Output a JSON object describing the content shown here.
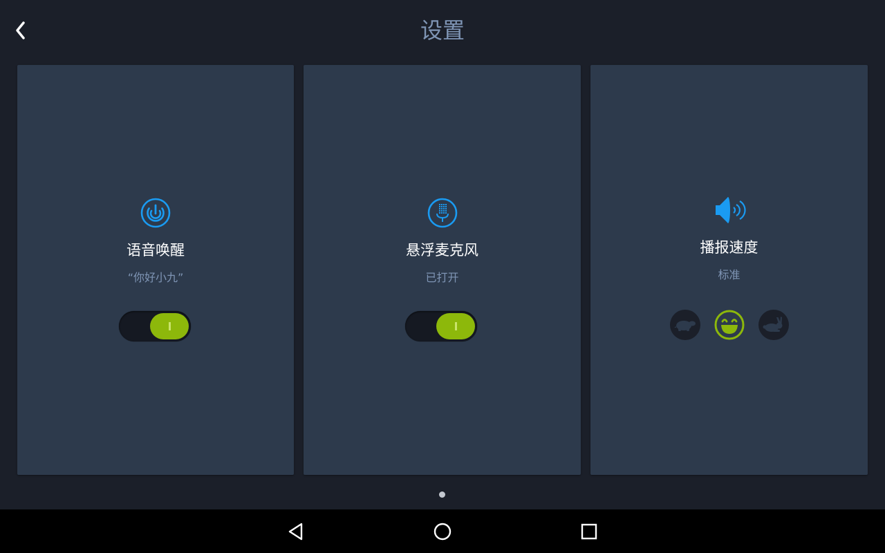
{
  "header": {
    "title": "设置",
    "back_icon": "chevron-left-icon"
  },
  "cards": [
    {
      "icon": "wake-power-icon",
      "title": "语音唤醒",
      "subtitle": "“你好小九”",
      "toggle_on": true
    },
    {
      "icon": "microphone-icon",
      "title": "悬浮麦克风",
      "subtitle": "已打开",
      "toggle_on": true
    },
    {
      "icon": "speaker-icon",
      "title": "播报速度",
      "subtitle": "标准",
      "speed_options": [
        "turtle-icon",
        "smiley-icon",
        "rabbit-icon"
      ],
      "selected_speed": 1
    }
  ],
  "pager": {
    "pages": 1,
    "current": 1
  },
  "navbar": {
    "back_icon": "nav-back-icon",
    "home_icon": "nav-home-icon",
    "recents_icon": "nav-recents-icon"
  },
  "colors": {
    "background": "#1b1f29",
    "card": "#2d3a4c",
    "accent_blue": "#1a9bf2",
    "toggle_green": "#8db80b",
    "subtitle": "#7f95b5"
  }
}
